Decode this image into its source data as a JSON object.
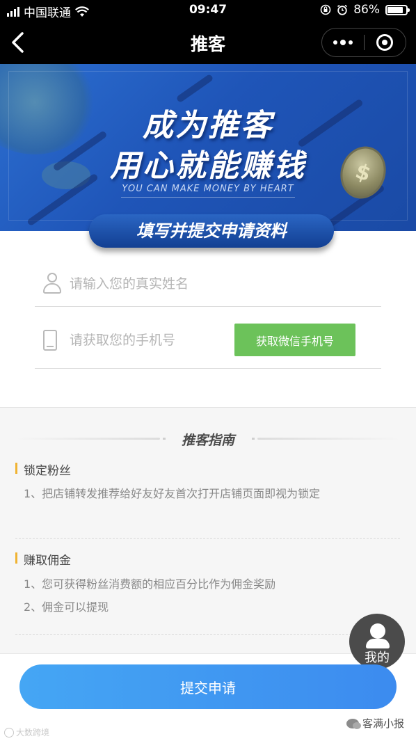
{
  "status_bar": {
    "carrier": "中国联通",
    "time": "09:47",
    "battery": "86%",
    "battery_level": 0.86
  },
  "nav": {
    "title": "推客"
  },
  "banner": {
    "line1": "成为推客",
    "line2": "用心就能赚钱",
    "subtitle": "YOU CAN MAKE MONEY BY HEART",
    "coin_symbol": "$",
    "ribbon": "填写并提交申请资料"
  },
  "form": {
    "name_placeholder": "请输入您的真实姓名",
    "phone_placeholder": "请获取您的手机号",
    "wechat_phone_button": "获取微信手机号"
  },
  "guide": {
    "title": "推客指南",
    "sections": [
      {
        "heading": "锁定粉丝",
        "items": [
          "1、把店铺转发推荐给好友好友首次打开店铺页面即视为锁定"
        ]
      },
      {
        "heading": "赚取佣金",
        "items": [
          "1、您可获得粉丝消费额的相应百分比作为佣金奖励",
          "2、佣金可以提现"
        ]
      }
    ]
  },
  "float_me": {
    "label": "我的"
  },
  "submit": {
    "label": "提交申请"
  },
  "watermarks": {
    "left": "大数跨境",
    "right": "客满小报"
  },
  "colors": {
    "green_button": "#6cc25a",
    "submit_blue": "#3c8bef",
    "accent_bar": "#f0b332",
    "banner_blue": "#1f55b8"
  }
}
